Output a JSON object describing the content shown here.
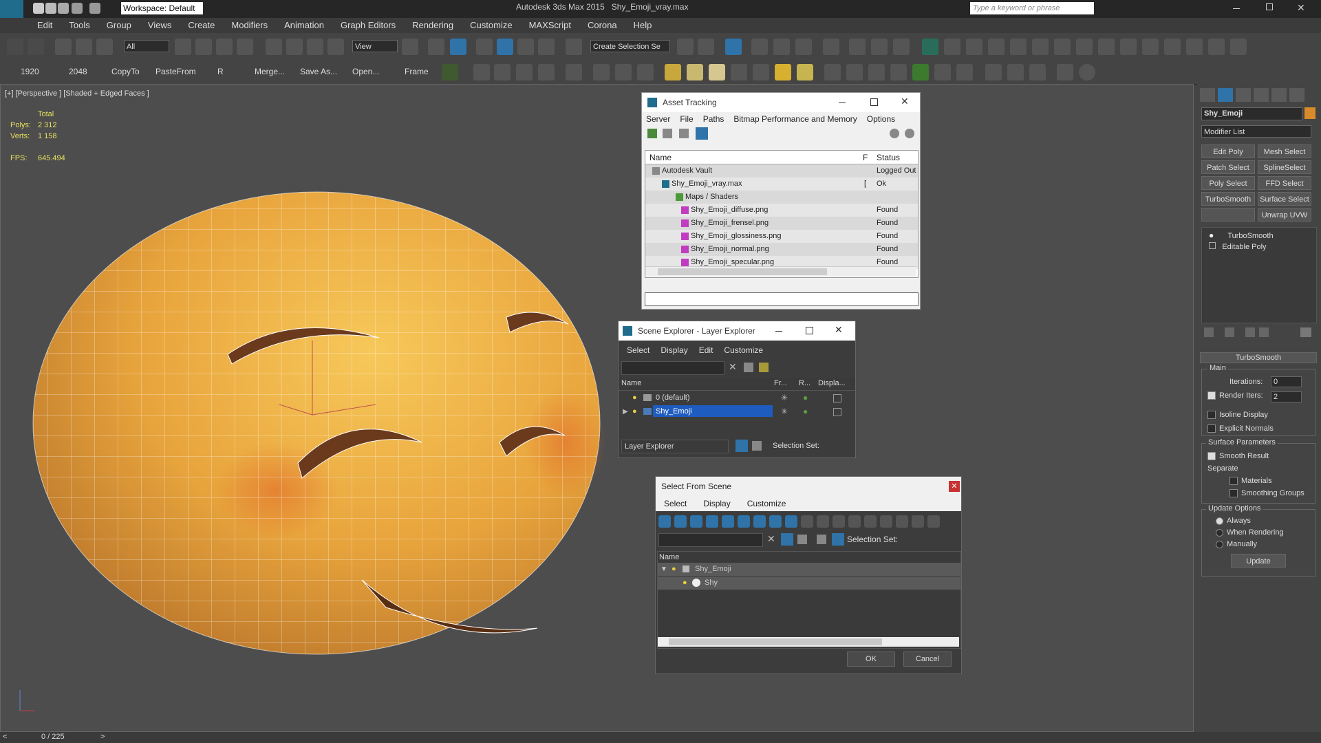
{
  "titlebar": {
    "app_title": "Autodesk 3ds Max  2015",
    "file_name": "Shy_Emoji_vray.max",
    "workspace": "Workspace: Default",
    "search_placeholder": "Type a keyword or phrase"
  },
  "menu": [
    "Edit",
    "Tools",
    "Group",
    "Views",
    "Create",
    "Modifiers",
    "Animation",
    "Graph Editors",
    "Rendering",
    "Customize",
    "MAXScript",
    "Corona",
    "Help"
  ],
  "toolbar1": {
    "selection_filter": "All",
    "ref_coord": "View",
    "selection_set": "Create Selection Se"
  },
  "toolbar2": {
    "buttons": [
      "1920",
      "2048",
      "CopyTo",
      "PasteFrom",
      "R",
      "Merge...",
      "Save As...",
      "Open...",
      "Frame"
    ]
  },
  "viewport": {
    "label": "[+] [Perspective ] [Shaded + Edged Faces ]",
    "stats_header": "Total",
    "polys_label": "Polys:",
    "polys_value": "2 312",
    "verts_label": "Verts:",
    "verts_value": "1 158",
    "fps_label": "FPS:",
    "fps_value": "645.494"
  },
  "statusbar": {
    "frame": "0 / 225"
  },
  "asset_tracking": {
    "title": "Asset Tracking",
    "menu": [
      "Server",
      "File",
      "Paths",
      "Bitmap Performance and Memory",
      "Options"
    ],
    "columns": [
      "Name",
      "F",
      "Status"
    ],
    "rows": [
      {
        "name": "Autodesk Vault",
        "f": "",
        "status": "Logged Out"
      },
      {
        "name": "Shy_Emoji_vray.max",
        "f": "[",
        "status": "Ok"
      },
      {
        "name": "Maps / Shaders",
        "f": "",
        "status": ""
      },
      {
        "name": "Shy_Emoji_diffuse.png",
        "f": "",
        "status": "Found"
      },
      {
        "name": "Shy_Emoji_frensel.png",
        "f": "",
        "status": "Found"
      },
      {
        "name": "Shy_Emoji_glossiness.png",
        "f": "",
        "status": "Found"
      },
      {
        "name": "Shy_Emoji_normal.png",
        "f": "",
        "status": "Found"
      },
      {
        "name": "Shy_Emoji_specular.png",
        "f": "",
        "status": "Found"
      }
    ]
  },
  "scene_explorer": {
    "title": "Scene Explorer - Layer Explorer",
    "menu": [
      "Select",
      "Display",
      "Edit",
      "Customize"
    ],
    "columns": [
      "Name",
      "Fr...",
      "R...",
      "Displa..."
    ],
    "rows": [
      {
        "name": "0 (default)"
      },
      {
        "name": "Shy_Emoji"
      }
    ],
    "footer_dropdown": "Layer Explorer",
    "selection_set": "Selection Set:"
  },
  "select_from_scene": {
    "title": "Select From Scene",
    "menu": [
      "Select",
      "Display",
      "Customize"
    ],
    "selection_set": "Selection Set:",
    "column": "Name",
    "rows": [
      "Shy_Emoji",
      "Shy"
    ],
    "ok": "OK",
    "cancel": "Cancel"
  },
  "command_panel": {
    "object_name": "Shy_Emoji",
    "modifier_list": "Modifier List",
    "mod_buttons": [
      "Edit Poly",
      "Mesh Select",
      "Patch Select",
      "SplineSelect",
      "Poly Select",
      "FFD Select",
      "TurboSmooth",
      "Surface Select",
      "",
      "Unwrap UVW"
    ],
    "stack": [
      "TurboSmooth",
      "Editable Poly"
    ],
    "rollout_title": "TurboSmooth",
    "main_label": "Main",
    "iterations_label": "Iterations:",
    "iterations_value": "0",
    "render_iters_label": "Render Iters:",
    "render_iters_value": "2",
    "isoline": "Isoline Display",
    "explicit_normals": "Explicit Normals",
    "surface_params": "Surface Parameters",
    "smooth_result": "Smooth Result",
    "separate": "Separate",
    "materials": "Materials",
    "smoothing_groups": "Smoothing Groups",
    "update_options": "Update Options",
    "always": "Always",
    "when_rendering": "When Rendering",
    "manually": "Manually",
    "update_button": "Update"
  }
}
